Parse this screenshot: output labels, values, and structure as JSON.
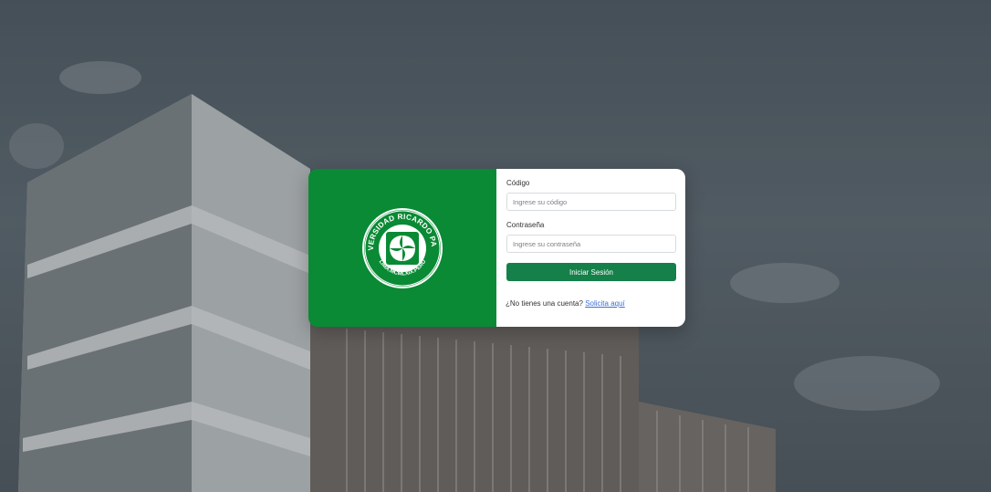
{
  "brand": {
    "logo_text_top": "UNIVERSIDAD RICARDO PALMA",
    "logo_text_bottom": "LIMA.MCMLXIX.PERU",
    "panel_color": "#0a8a34"
  },
  "login_form": {
    "code_label": "Código",
    "code_placeholder": "Ingrese su código",
    "password_label": "Contraseña",
    "password_placeholder": "Ingrese su contraseña",
    "submit_label": "Iniciar Sesión",
    "submit_color": "#15804a",
    "no_account_text": "¿No tienes una cuenta?",
    "request_link_text": "Solicita aquí",
    "link_color": "#3b6fd8"
  },
  "background": {
    "icon": "campus-building-photo"
  }
}
